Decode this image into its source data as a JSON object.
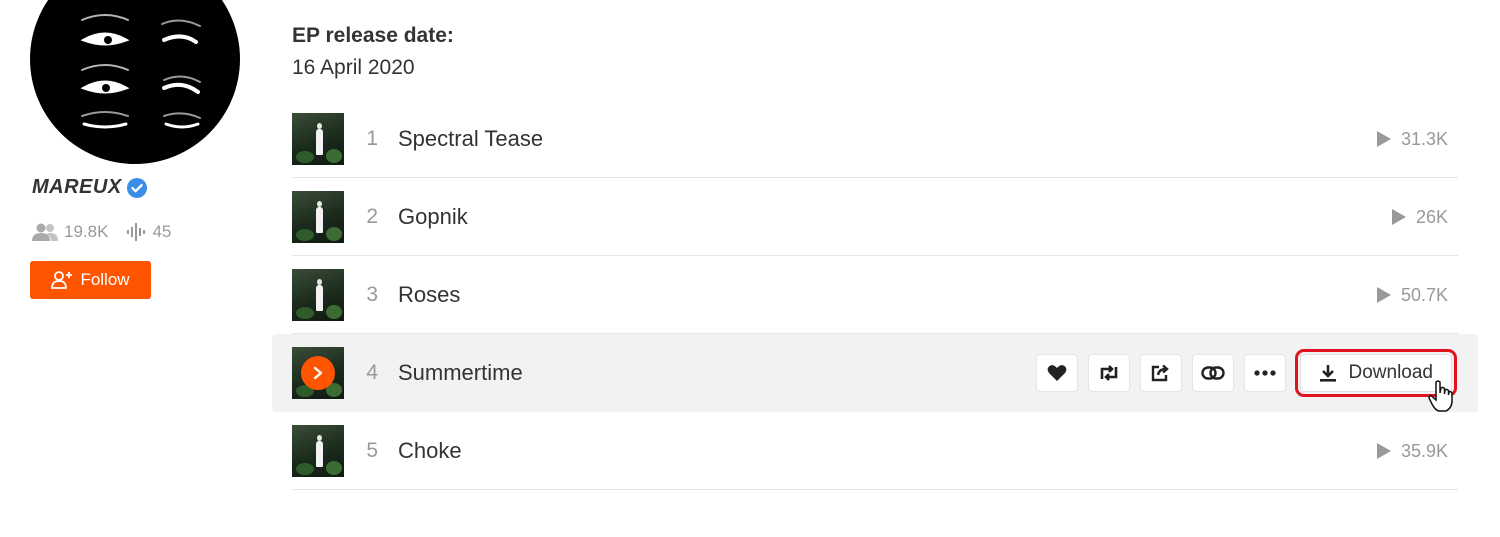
{
  "artist": {
    "name": "MAREUX",
    "followers": "19.8K",
    "tracks_count": "45",
    "follow_label": "Follow"
  },
  "release": {
    "label": "EP release date:",
    "date": "16 April 2020"
  },
  "tracks": [
    {
      "number": "1",
      "title": "Spectral Tease",
      "plays": "31.3K"
    },
    {
      "number": "2",
      "title": "Gopnik",
      "plays": "26K"
    },
    {
      "number": "3",
      "title": "Roses",
      "plays": "50.7K"
    },
    {
      "number": "4",
      "title": "Summertime",
      "plays": ""
    },
    {
      "number": "5",
      "title": "Choke",
      "plays": "35.9K"
    }
  ],
  "actions": {
    "download_label": "Download"
  },
  "colors": {
    "accent": "#ff5500",
    "highlight": "#e0141e",
    "verified": "#3b8ee8"
  }
}
